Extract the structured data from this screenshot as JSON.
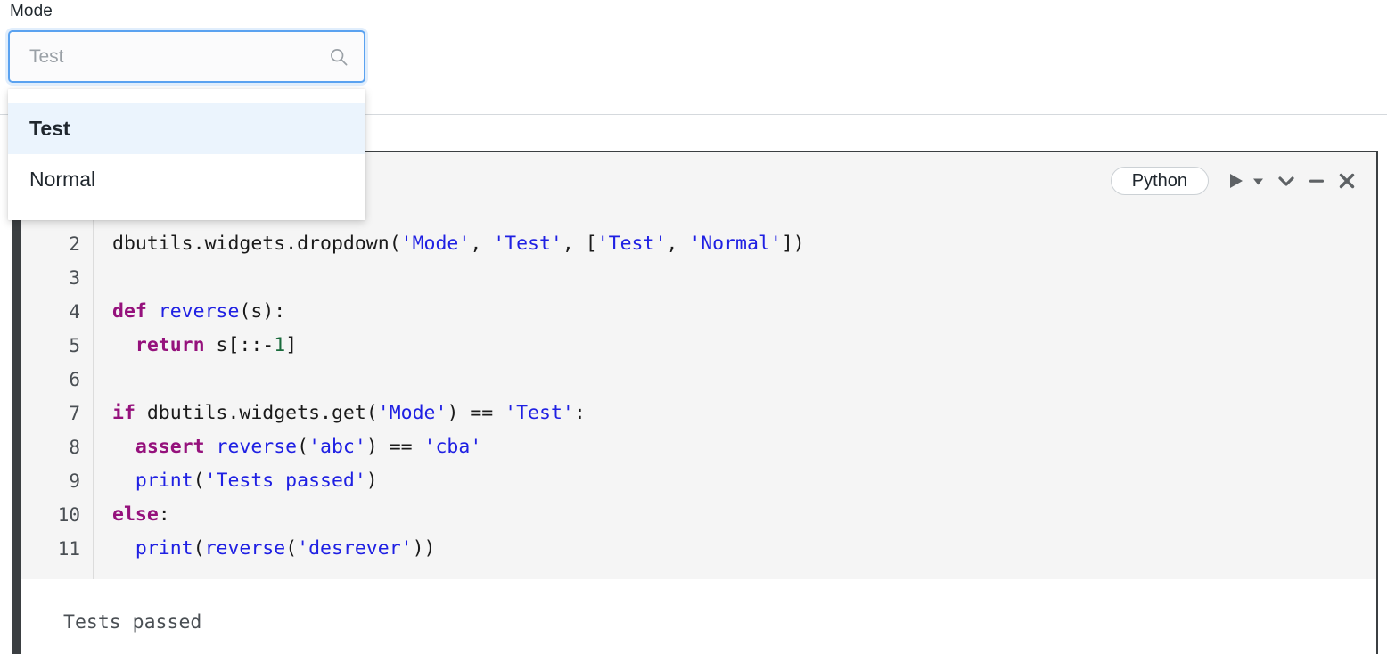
{
  "widget": {
    "label": "Mode",
    "input_value": "",
    "input_placeholder": "Test",
    "search_icon": "search-icon",
    "options": [
      {
        "label": "Test",
        "selected": true
      },
      {
        "label": "Normal",
        "selected": false
      }
    ]
  },
  "cell": {
    "toolbar": {
      "language": "Python",
      "icons": [
        {
          "name": "run-icon",
          "glyph": "▶"
        },
        {
          "name": "run-dropdown-caret-icon",
          "glyph": "▼"
        },
        {
          "name": "chevron-down-icon",
          "glyph": "∨"
        },
        {
          "name": "minimize-icon",
          "glyph": "—"
        },
        {
          "name": "close-icon",
          "glyph": "✖"
        }
      ]
    },
    "line_numbers": [
      "2",
      "3",
      "4",
      "5",
      "6",
      "7",
      "8",
      "9",
      "10",
      "11"
    ],
    "code_lines": [
      {
        "number": "2",
        "text": "dbutils.widgets.dropdown('Mode', 'Test', ['Test', 'Normal'])"
      },
      {
        "number": "3",
        "text": ""
      },
      {
        "number": "4",
        "text": "def reverse(s):"
      },
      {
        "number": "5",
        "text": "  return s[::-1]"
      },
      {
        "number": "6",
        "text": ""
      },
      {
        "number": "7",
        "text": "if dbutils.widgets.get('Mode') == 'Test':"
      },
      {
        "number": "8",
        "text": "  assert reverse('abc') == 'cba'"
      },
      {
        "number": "9",
        "text": "  print('Tests passed')"
      },
      {
        "number": "10",
        "text": "else:"
      },
      {
        "number": "11",
        "text": "  print(reverse('desrever'))"
      }
    ],
    "output": "Tests passed"
  },
  "colors": {
    "accent_focus": "#5aa2f0",
    "option_selected_bg": "#ebf4fd",
    "code_bg": "#f5f5f5",
    "cell_border": "#3b3f42",
    "keyword": "#95117c",
    "string": "#1f20e3",
    "number": "#1a6b3c",
    "icon": "#5e6265"
  }
}
